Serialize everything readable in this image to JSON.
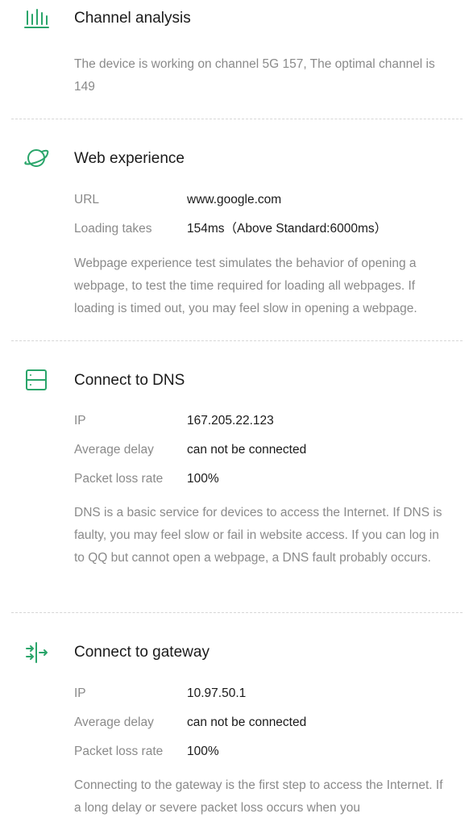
{
  "colors": {
    "accent": "#2aa56a",
    "text": "#1a1a1a",
    "muted": "#8a8a8a",
    "divider": "#d6d6d6"
  },
  "sections": {
    "channel": {
      "icon": "signal-bars-icon",
      "title": "Channel analysis",
      "description": "The device is working on channel 5G 157, The optimal channel is 149"
    },
    "web": {
      "icon": "planet-icon",
      "title": "Web experience",
      "rows": [
        {
          "label": "URL",
          "value": "www.google.com"
        },
        {
          "label": "Loading takes",
          "value": "154ms（Above Standard:6000ms）"
        }
      ],
      "description": "Webpage experience test simulates the behavior of opening a webpage, to test the time required for loading all webpages. If loading is timed out, you may feel slow in opening a webpage."
    },
    "dns": {
      "icon": "server-icon",
      "title": "Connect to DNS",
      "rows": [
        {
          "label": "IP",
          "value": "167.205.22.123"
        },
        {
          "label": "Average delay",
          "value": "can not be connected"
        },
        {
          "label": "Packet loss rate",
          "value": "100%"
        }
      ],
      "description": "DNS is a basic service for devices to access the Internet. If DNS is faulty, you may feel slow or fail in website access. If you can log in to QQ but cannot open a webpage, a DNS fault probably occurs."
    },
    "gateway": {
      "icon": "gateway-arrows-icon",
      "title": "Connect to gateway",
      "rows": [
        {
          "label": "IP",
          "value": "10.97.50.1"
        },
        {
          "label": "Average delay",
          "value": "can not be connected"
        },
        {
          "label": "Packet loss rate",
          "value": "100%"
        }
      ],
      "description": "Connecting to the gateway is the first step to access the Internet. If a long delay or severe packet loss occurs when you"
    }
  }
}
